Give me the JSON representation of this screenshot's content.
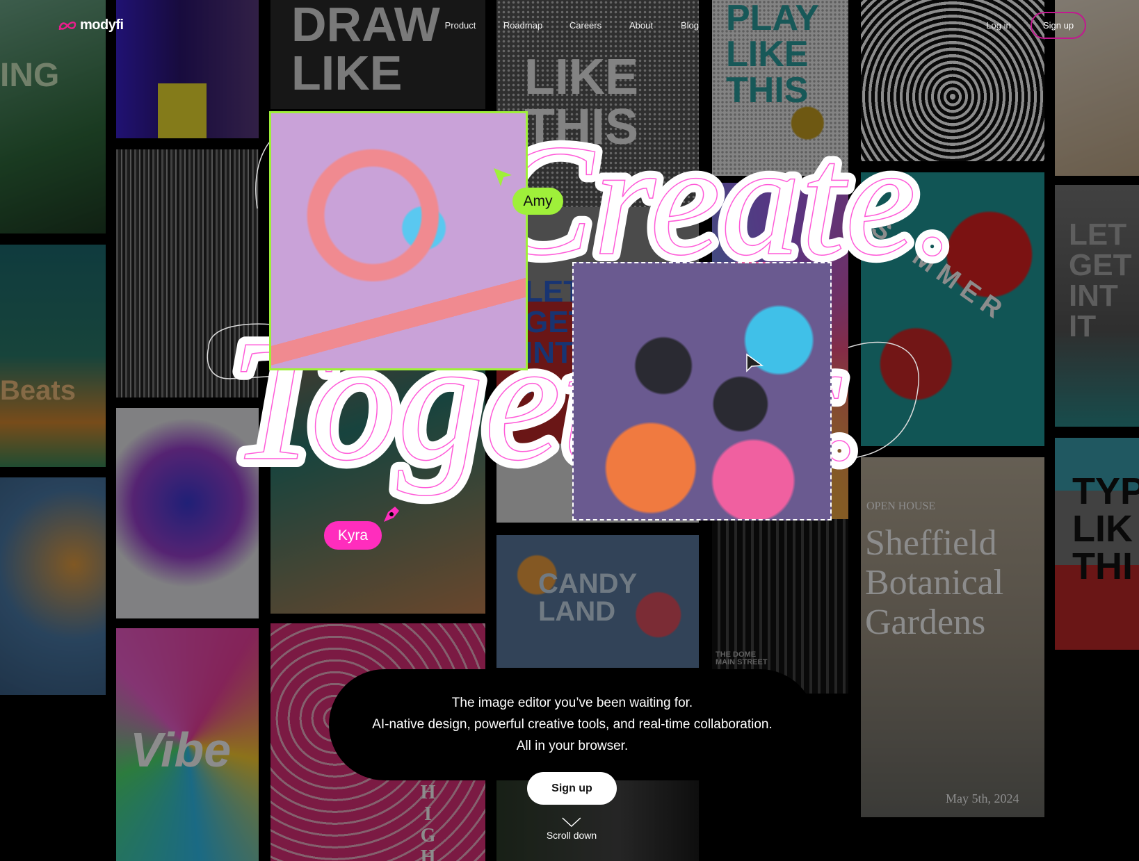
{
  "brand": {
    "name": "modyfi",
    "accent": "#e91e8c"
  },
  "nav": {
    "links": [
      "Product",
      "Roadmap",
      "Careers",
      "About",
      "Blog"
    ],
    "login": "Log in",
    "signup": "Sign up"
  },
  "headline": {
    "line1": "Create.",
    "line2": "Together."
  },
  "collaborators": [
    {
      "name": "Amy",
      "color": "#9ff03a"
    },
    {
      "name": "Kyra",
      "color": "#ff2dbd"
    }
  ],
  "hero": {
    "lines": [
      "The image editor you’ve been waiting for.",
      "AI-native design, powerful creative tools, and real-time collaboration.",
      "All in your browser."
    ],
    "cta": "Sign up",
    "scroll": "Scroll down"
  },
  "posters": {
    "ing": "ING",
    "beats": "Beats",
    "draw": "DRAW\nLIKE",
    "type": "LIKE\nTHIS",
    "play": "PLAY\nLIKE\nTHIS",
    "summer": "SUMMER",
    "let": "LET\nGET\nINTO\nIT",
    "candy": "CANDY\nLAND",
    "dome": "THE DOME\nMAIN STREET",
    "high": "HIGH",
    "vibe": "Vibe",
    "open": "OPEN HOUSE",
    "sheffield": "Sheffield\nBotanical\nGardens",
    "date": "May 5th, 2024",
    "typeR": "TYP\nLIK\nTHI",
    "letR": "LET\nGET\nINT\nIT"
  }
}
